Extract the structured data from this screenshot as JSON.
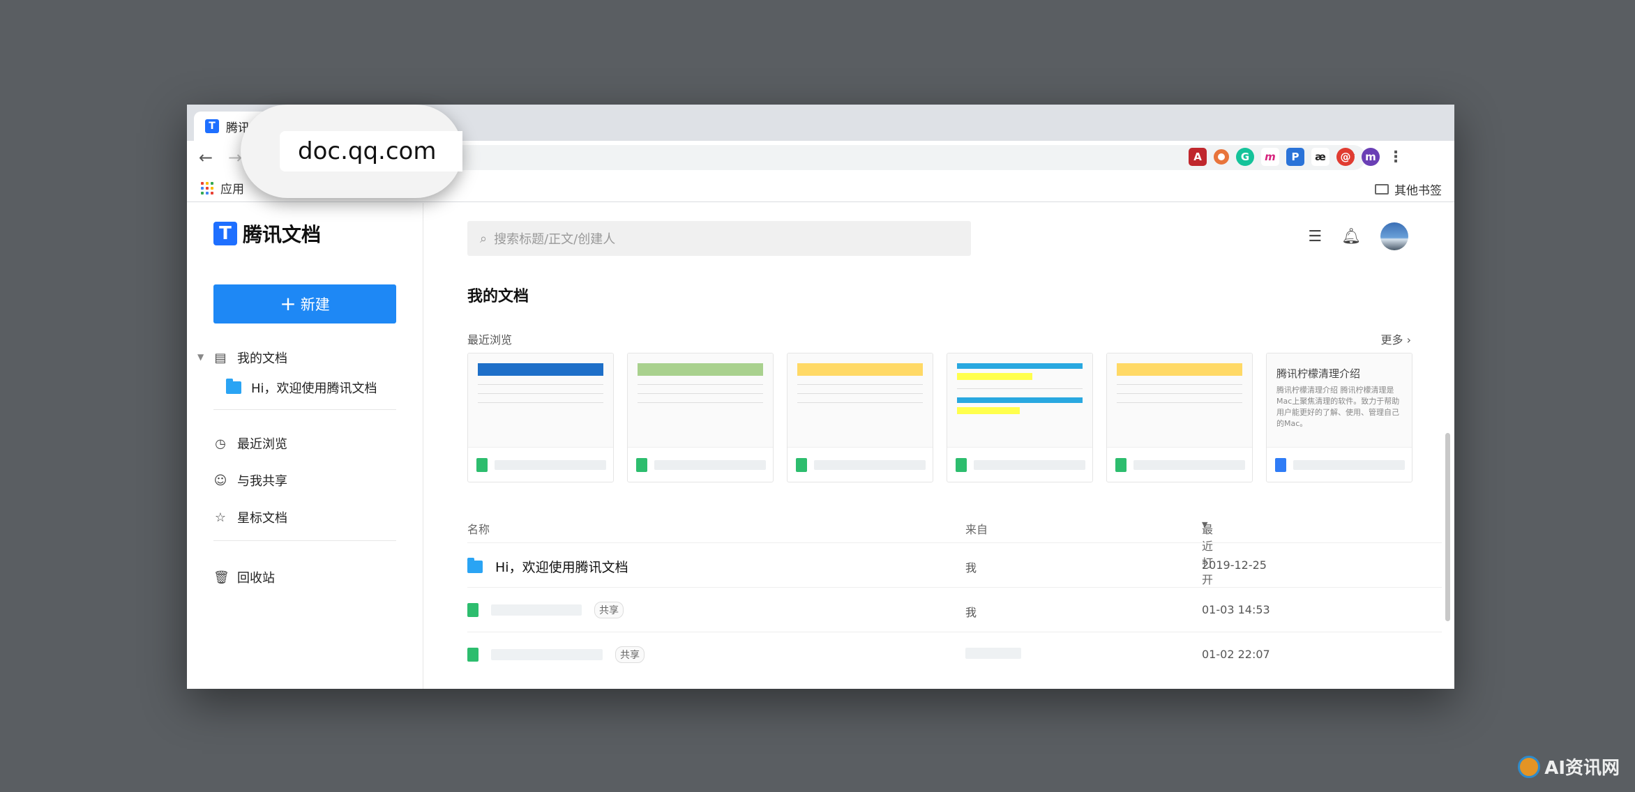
{
  "browser": {
    "tab_title": "腾讯",
    "url": "doc.qq.com",
    "bookmarks": {
      "apps": "应用",
      "other": "其他书签"
    },
    "extensions": [
      "pdf-icon",
      "color-wheel-icon",
      "grammarly-icon",
      "m-icon",
      "p-icon",
      "ae-icon",
      "red-circle-icon"
    ],
    "profile_initial": "m"
  },
  "app": {
    "logo_text": "腾讯文档",
    "new_button": "新建",
    "search_placeholder": "搜索标题/正文/创建人",
    "sidebar": {
      "my_docs": "我的文档",
      "welcome_folder": "Hi，欢迎使用腾讯文档",
      "recent": "最近浏览",
      "shared": "与我共享",
      "starred": "星标文档",
      "trash": "回收站"
    },
    "main_title": "我的文档",
    "recent_label": "最近浏览",
    "more_label": "更多",
    "doc_card": {
      "title": "腾讯柠檬清理介绍",
      "body": "腾讯柠檬清理介绍 腾讯柠檬清理是Mac上聚焦清理的软件。致力于帮助用户能更好的了解、使用、管理自己的Mac。"
    },
    "table": {
      "col_name": "名称",
      "col_from": "来自",
      "col_opened": "最近打开",
      "rows": [
        {
          "name": "Hi，欢迎使用腾讯文档",
          "badge": "",
          "from": "我",
          "time": "2019-12-25"
        },
        {
          "name": "",
          "badge": "共享",
          "from": "我",
          "time": "01-03 14:53"
        },
        {
          "name": "",
          "badge": "共享",
          "from": "",
          "time": "01-02 22:07"
        }
      ]
    }
  },
  "watermark": "AI资讯网",
  "colors": {
    "accent": "#1e88f5",
    "sheet": "#2dbd6e",
    "doc": "#2f7cf6",
    "folder": "#2aa4f4"
  }
}
